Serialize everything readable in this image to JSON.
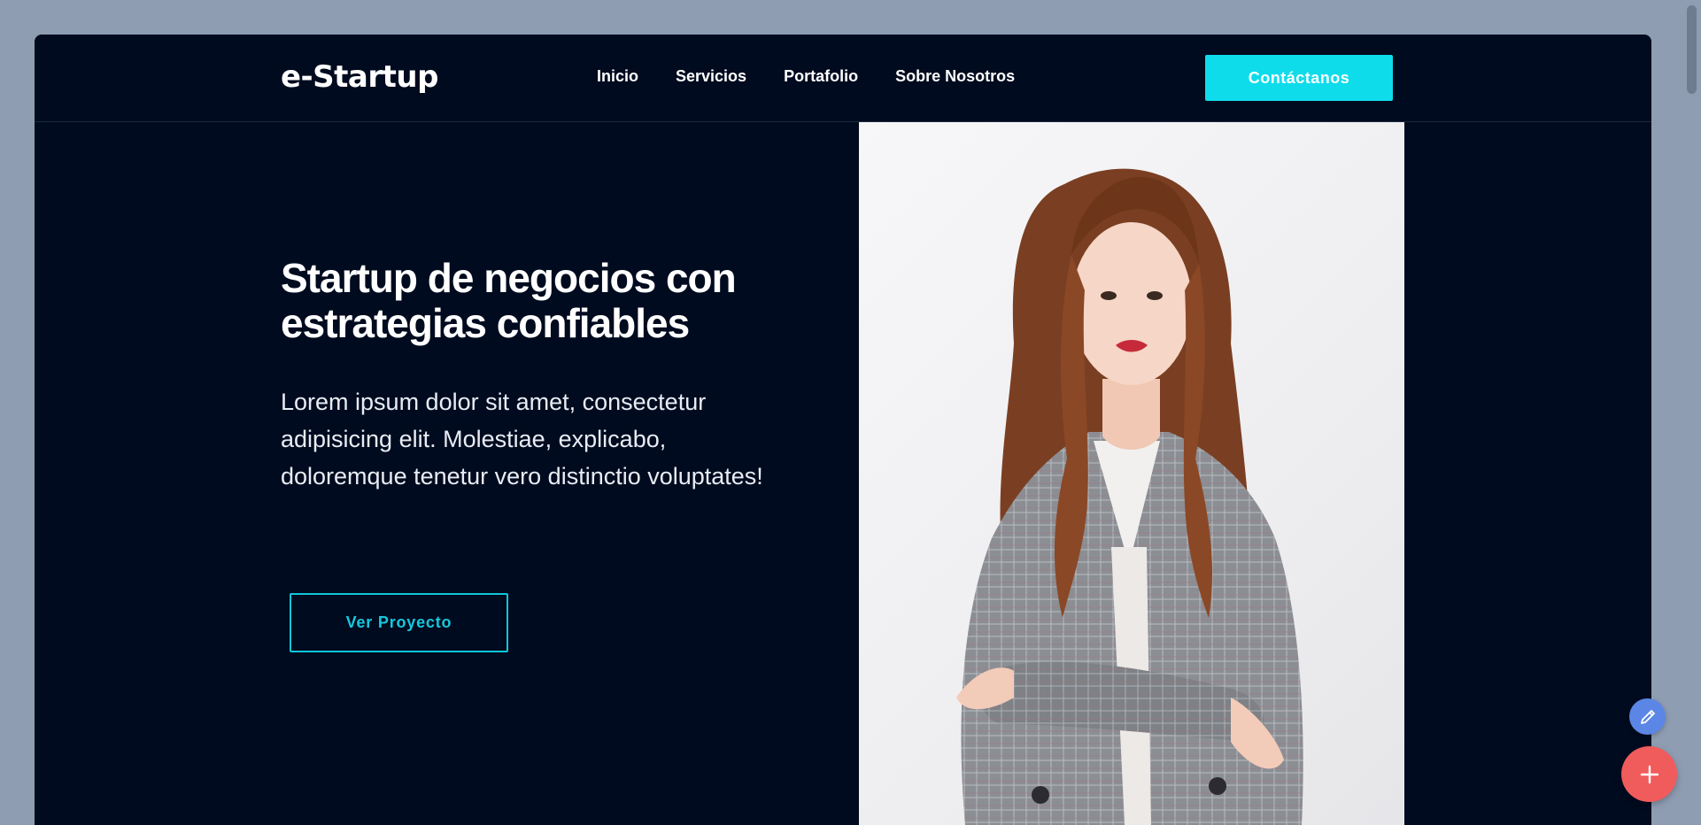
{
  "header": {
    "logo": "e-Startup",
    "nav": [
      "Inicio",
      "Servicios",
      "Portafolio",
      "Sobre Nosotros"
    ],
    "cta_label": "Contáctanos"
  },
  "hero": {
    "title": "Startup de negocios con estrategias confiables",
    "text": "Lorem ipsum dolor sit amet, consectetur adipisicing elit. Molestiae, explicabo, doloremque tenetur vero distinctio voluptates!",
    "button_label": "Ver Proyecto"
  },
  "colors": {
    "page_bg": "#8f9db3",
    "frame_bg": "#000b1f",
    "accent": "#0fdcea",
    "fab_edit": "#5b86e5",
    "fab_add": "#f05b5b"
  },
  "icons": {
    "edit": "pencil-icon",
    "add": "plus-icon"
  }
}
